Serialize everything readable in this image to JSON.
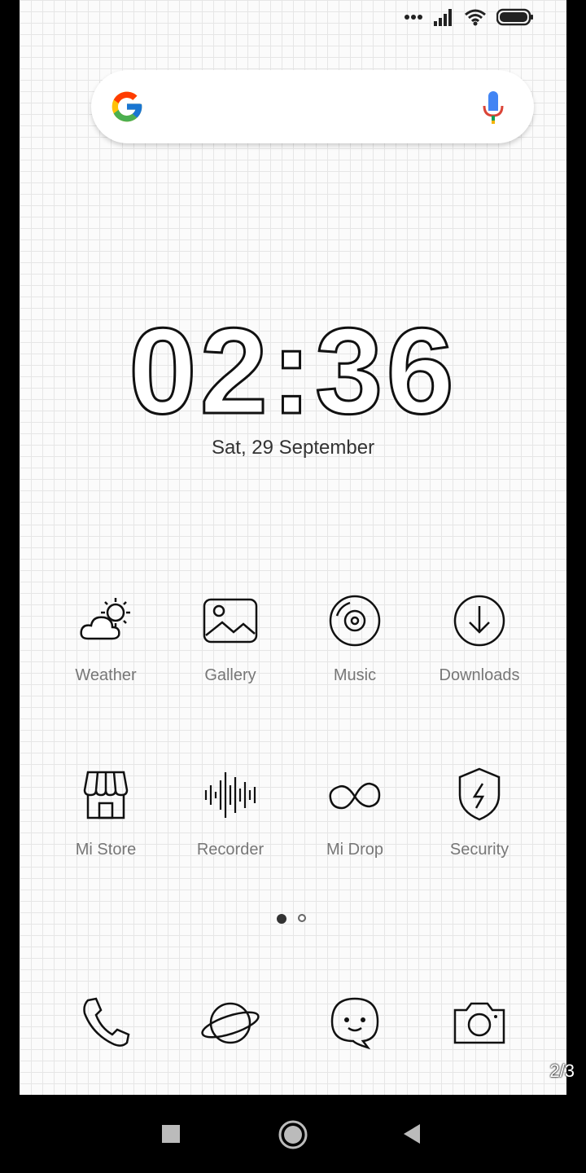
{
  "status_bar": {
    "icons": [
      "more-dots-icon",
      "signal-icon",
      "wifi-icon",
      "battery-icon"
    ]
  },
  "search": {
    "logo": "google-logo-icon",
    "mic": "mic-icon"
  },
  "clock": {
    "time": "02:36",
    "date": "Sat, 29 September"
  },
  "apps_row1": [
    {
      "label": "Weather",
      "icon": "weather-icon"
    },
    {
      "label": "Gallery",
      "icon": "gallery-icon"
    },
    {
      "label": "Music",
      "icon": "music-icon"
    },
    {
      "label": "Downloads",
      "icon": "downloads-icon"
    }
  ],
  "apps_row2": [
    {
      "label": "Mi Store",
      "icon": "store-icon"
    },
    {
      "label": "Recorder",
      "icon": "recorder-icon"
    },
    {
      "label": "Mi Drop",
      "icon": "infinity-icon"
    },
    {
      "label": "Security",
      "icon": "shield-icon"
    }
  ],
  "page_dots": {
    "total": 2,
    "active": 1
  },
  "dock": [
    {
      "icon": "phone-icon"
    },
    {
      "icon": "browser-planet-icon"
    },
    {
      "icon": "messaging-icon"
    },
    {
      "icon": "camera-icon"
    }
  ],
  "page_indicator": "2/3",
  "nav": {
    "buttons": [
      "recents-square-icon",
      "home-circle-icon",
      "back-triangle-icon"
    ]
  }
}
